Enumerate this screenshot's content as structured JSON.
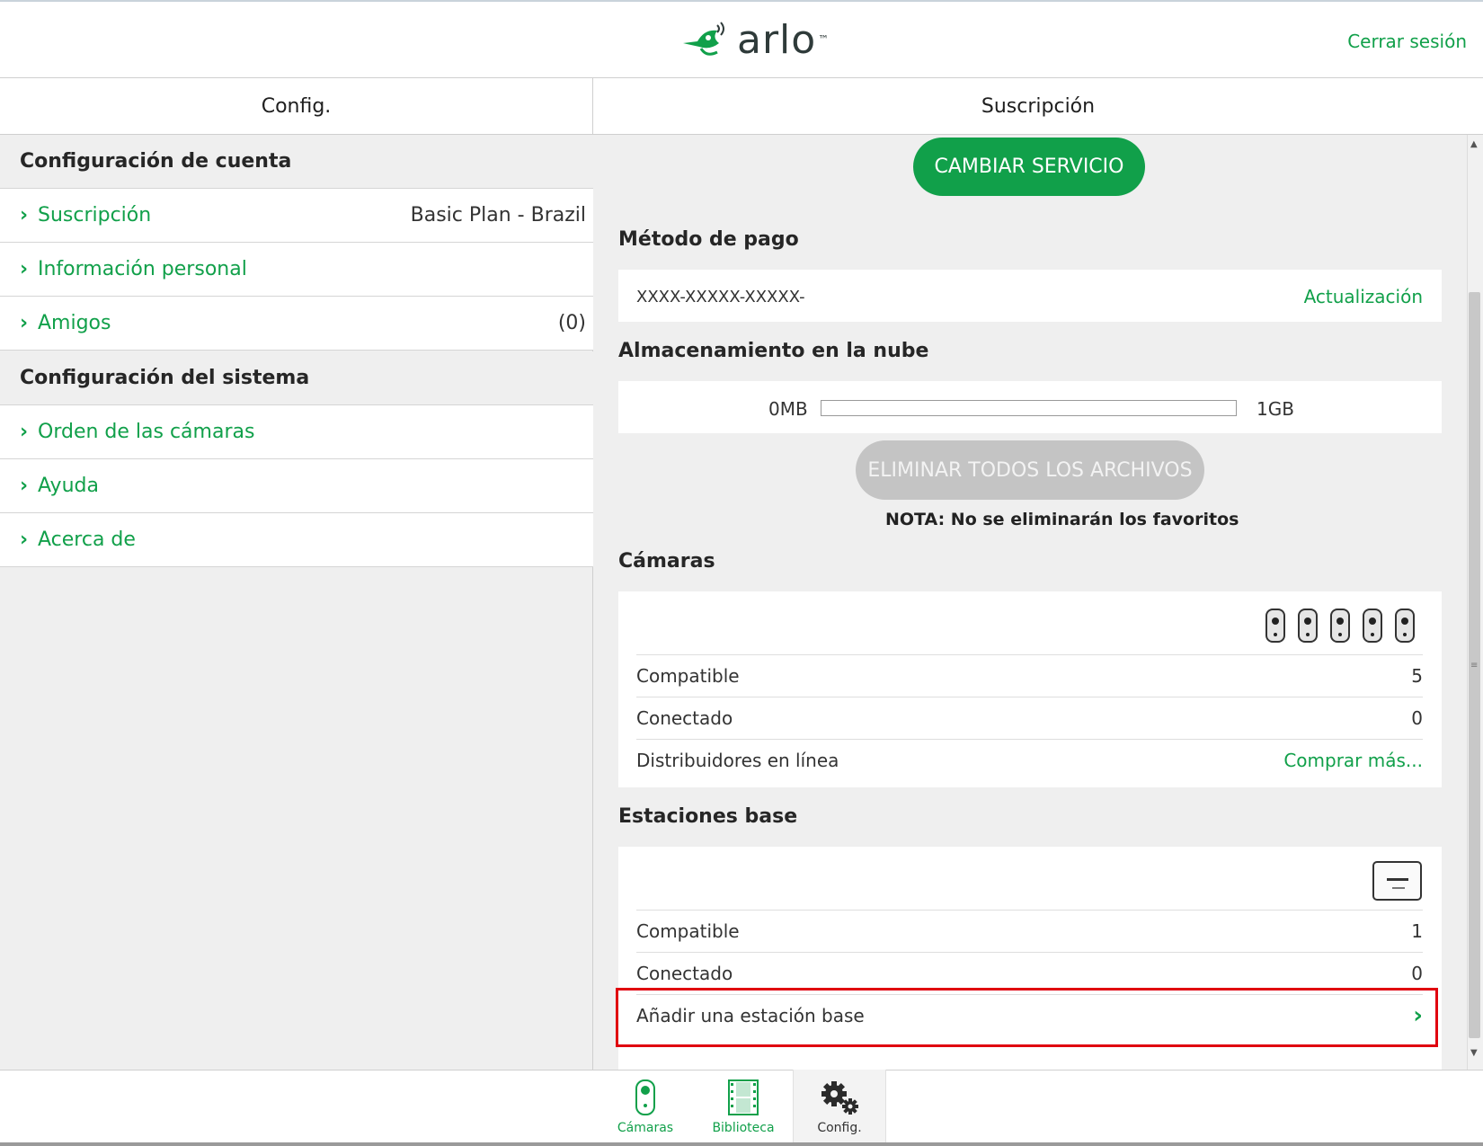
{
  "header": {
    "logo_text": "arlo",
    "logo_tm": "™",
    "logout": "Cerrar sesión"
  },
  "columns": {
    "left_title": "Config.",
    "right_title": "Suscripción"
  },
  "sidebar": {
    "account_section": "Configuración de cuenta",
    "system_section": "Configuración del sistema",
    "items": [
      {
        "label": "Suscripción",
        "value": "Basic Plan - Brazil"
      },
      {
        "label": "Información personal",
        "value": ""
      },
      {
        "label": "Amigos",
        "value": "(0)"
      },
      {
        "label": "Orden de las cámaras",
        "value": ""
      },
      {
        "label": "Ayuda",
        "value": ""
      },
      {
        "label": "Acerca de",
        "value": ""
      }
    ],
    "chevron": "›"
  },
  "subscription": {
    "change_service_button": "CAMBIAR SERVICIO",
    "payment": {
      "title": "Método de pago",
      "card_number": "XXXX-XXXXX-XXXXX-",
      "update_link": "Actualización"
    },
    "storage": {
      "title": "Almacenamiento en la nube",
      "min_label": "0MB",
      "max_label": "1GB",
      "used_fraction": 0,
      "delete_all_button": "ELIMINAR TODOS LOS ARCHIVOS",
      "note": "NOTA: No se eliminarán los favoritos"
    },
    "cameras": {
      "title": "Cámaras",
      "icon_count": 5,
      "rows": [
        {
          "label": "Compatible",
          "value": "5"
        },
        {
          "label": "Conectado",
          "value": "0"
        },
        {
          "label": "Distribuidores en línea",
          "link": "Comprar más..."
        }
      ]
    },
    "base_stations": {
      "title": "Estaciones base",
      "rows": [
        {
          "label": "Compatible",
          "value": "1"
        },
        {
          "label": "Conectado",
          "value": "0"
        }
      ],
      "add_label": "Añadir una estación base",
      "add_chevron": "›"
    }
  },
  "bottom_nav": {
    "tabs": [
      {
        "label": "Cámaras",
        "icon": "camera-icon"
      },
      {
        "label": "Biblioteca",
        "icon": "film-icon"
      },
      {
        "label": "Config.",
        "icon": "gears-icon"
      }
    ]
  },
  "colors": {
    "accent": "#11a04a",
    "highlight": "#e0000f",
    "disabled_button": "#c4c4c4"
  }
}
